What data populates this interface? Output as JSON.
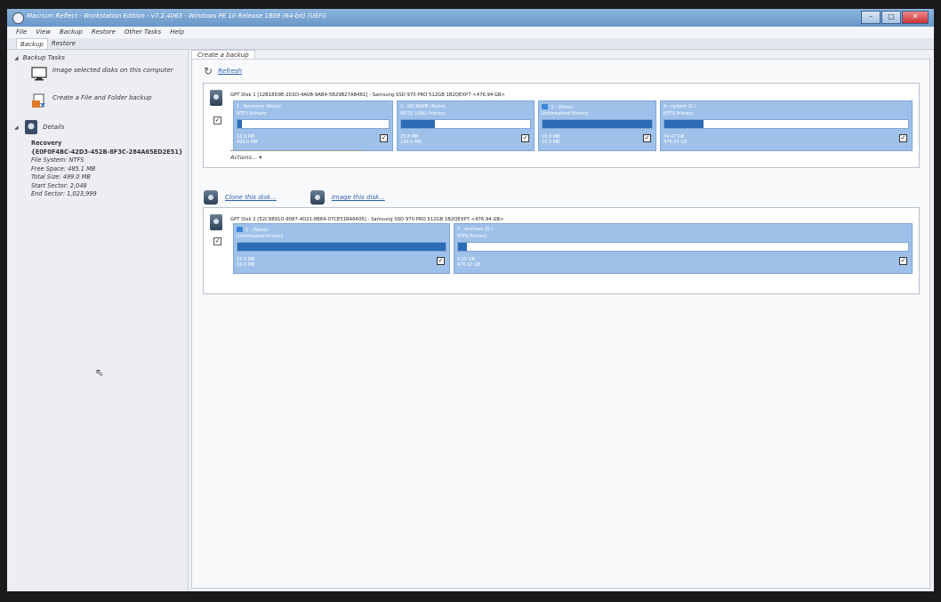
{
  "window": {
    "title": "Macrium Reflect - Workstation Edition - v7.2.4063 - Windows PE 10 Release 1809 (64-bit) (UEFI)",
    "minimize": "–",
    "maximize": "□",
    "close": "✕"
  },
  "menu": [
    "File",
    "View",
    "Backup",
    "Restore",
    "Other Tasks",
    "Help"
  ],
  "top_tabs": [
    "Backup",
    "Restore"
  ],
  "left": {
    "backup_tasks_header": "Backup Tasks",
    "task_image": "Image selected disks on this computer",
    "task_file": "Create a File and Folder backup",
    "details_header": "Details",
    "details": {
      "name": "Recovery",
      "guid": "{E0F0F4BC-42D3-452B-8F3C-284A65ED2E51}",
      "fs": "File System: NTFS",
      "free": "Free Space:  485.1 MB",
      "total": "Total Size:  499.0 MB",
      "start": "Start Sector:  2,048",
      "end": "End Sector:   1,023,999"
    }
  },
  "main": {
    "tab": "Create a backup",
    "refresh": "Refresh",
    "actions": "Actions... ▾",
    "clone": "Clone this disk...",
    "image": "Image this disk..."
  },
  "disks": [
    {
      "header": "GPT Disk 1 [12B18D9E-2D1D-4A0B-9AB4-5B29B27AB461] - Samsung SSD 970 PRO 512GB 1B2QEXP7  <476.94 GB>",
      "partitions": [
        {
          "name": "1 - Recovery (None)",
          "type": "NTFS Primary",
          "used": "13.9 MB",
          "total": "499.0 MB",
          "fill": 0.03
        },
        {
          "name": "2 - NO NAME (None)",
          "type": "FAT32 (LBA) Primary",
          "used": "25.8 MB",
          "total": "100.0 MB",
          "fill": 0.26
        },
        {
          "name": "3 - (None)",
          "type": "Unformatted Primary",
          "used": "16.0 MB",
          "total": "16.0 MB",
          "fill": 1.0
        },
        {
          "name": "4 - system (C:)",
          "type": "NTFS Primary",
          "used": "74.47 GB",
          "total": "476.34 GB",
          "fill": 0.16
        }
      ]
    },
    {
      "header": "GPT Disk 2 [52C8891D-9087-4D21-8B64-07CE51BA6606] - Samsung SSD 970 PRO 512GB 1B2QEXP7  <476.94 GB>",
      "partitions": [
        {
          "name": "1 - (None)",
          "type": "Unformatted Primary",
          "used": "16.0 MB",
          "total": "16.0 MB",
          "fill": 1.0
        },
        {
          "name": "2 - archives (D:)",
          "type": "NTFS Primary",
          "used": "9.20 GB",
          "total": "476.92 GB",
          "fill": 0.02
        }
      ]
    }
  ],
  "colors": {
    "accent": "#2d6cb5",
    "partition": "#9fc1e9",
    "link": "#2a5fae"
  }
}
